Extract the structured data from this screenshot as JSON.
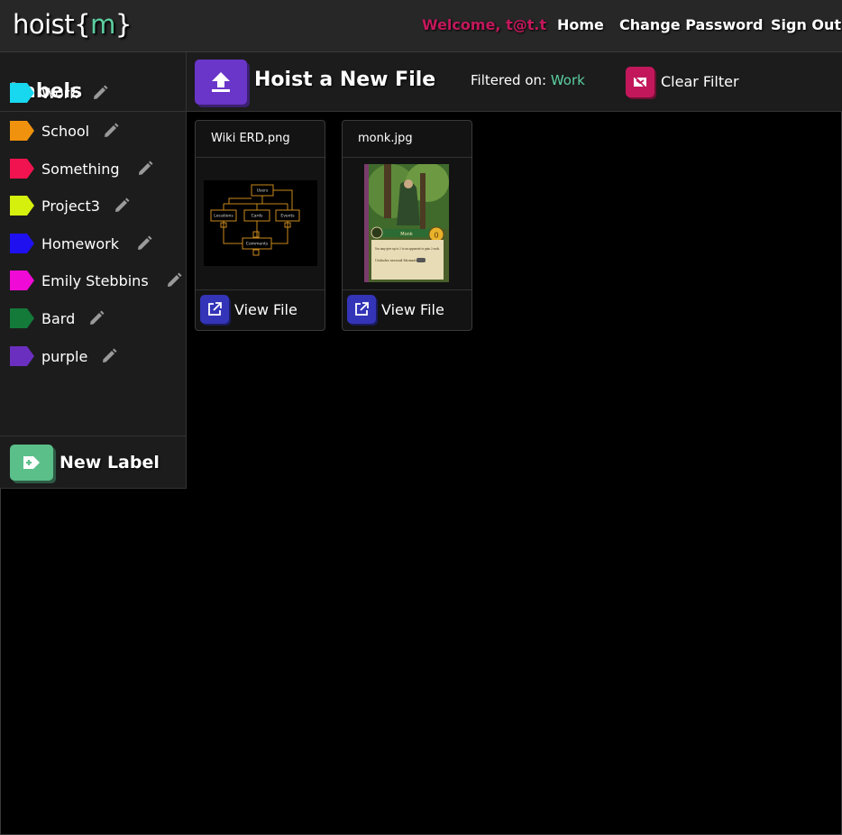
{
  "navbar": {
    "brand_word": "hoist",
    "brand_open": "{",
    "brand_m": "m",
    "brand_close": "}",
    "welcome": "Welcome, t@t.t",
    "home": "Home",
    "change_password": "Change Password",
    "sign_out": "Sign Out"
  },
  "sidebar": {
    "title": "Labels",
    "labels": [
      {
        "name": "Work",
        "color": "#18d8f0"
      },
      {
        "name": "School",
        "color": "#f0920e"
      },
      {
        "name": "Something",
        "color": "#f0134f"
      },
      {
        "name": "Project3",
        "color": "#d6f00e"
      },
      {
        "name": "Homework",
        "color": "#1f10f0"
      },
      {
        "name": "Emily Stebbins",
        "color": "#f00ad6"
      },
      {
        "name": "Bard",
        "color": "#137a3a"
      },
      {
        "name": "purple",
        "color": "#6a2fbf"
      }
    ],
    "new_label": "New Label"
  },
  "toolbar": {
    "upload_label": "Hoist a New File",
    "filter_prefix": "Filtered on:",
    "filter_value": "Work",
    "clear_filter": "Clear Filter"
  },
  "files": [
    {
      "name": "Wiki ERD.png",
      "view_label": "View File",
      "thumb": "erd-diagram"
    },
    {
      "name": "monk.jpg",
      "view_label": "View File",
      "thumb": "monk-card"
    }
  ],
  "erd_boxes": [
    "Users",
    "Locations",
    "Cards",
    "Events",
    "Comments"
  ],
  "monk_card": {
    "name": "Monk",
    "value": "0",
    "text_1": "You may give up to 2 to an opponent to gain 2 each.",
    "text_2": "Unlocks second Monastery"
  },
  "colors": {
    "accent_green": "#5bcfa0",
    "welcome_pink": "#c2185b",
    "upload_purple": "#6a35c9",
    "view_blue": "#3434b8",
    "new_label_green": "#5bbf8a"
  },
  "icons": {
    "upload": "upload-icon",
    "clear": "eye-off-icon",
    "view": "external-link-icon",
    "edit": "pencil-icon",
    "new_label": "tag-plus-icon"
  }
}
